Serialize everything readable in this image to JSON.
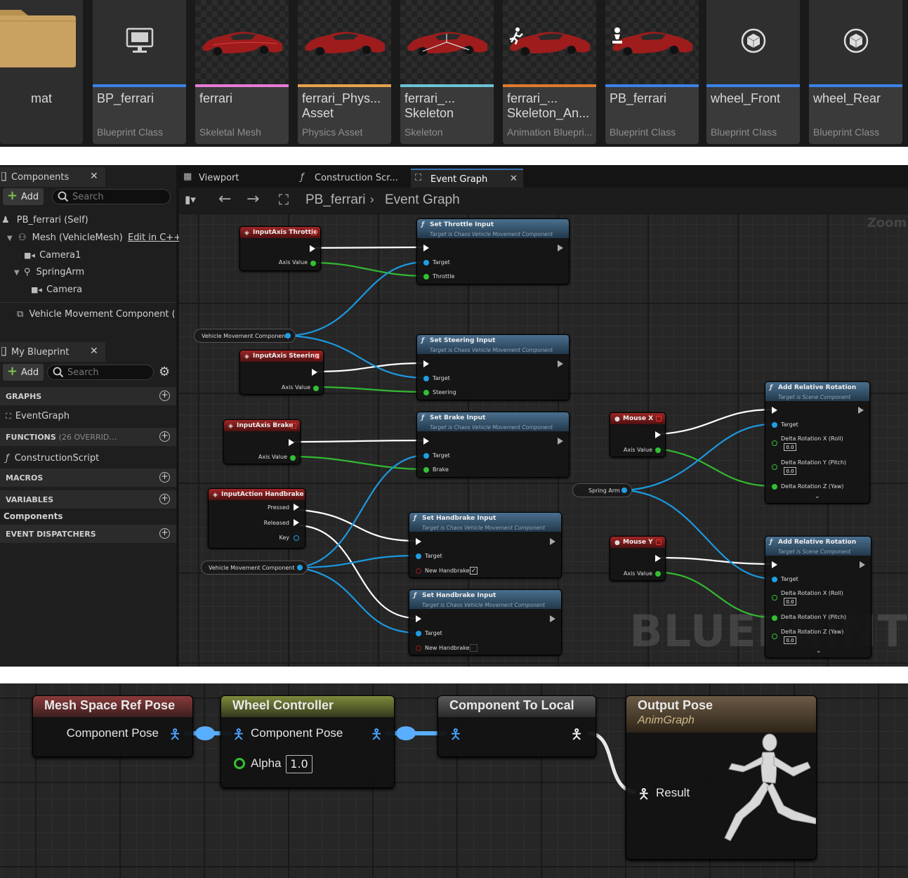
{
  "content_browser": {
    "folder": {
      "name": "mat"
    },
    "assets": [
      {
        "name": "BP_ferrari",
        "type": "Blueprint Class",
        "color": "#3a82e8",
        "thumb": "pawn-monitor-icon"
      },
      {
        "name": "ferrari",
        "type": "Skeletal Mesh",
        "color": "#e67bd8",
        "thumb": "red-car"
      },
      {
        "name": "ferrari_Phys...\nAsset",
        "type": "Physics Asset",
        "color": "#e9a24b",
        "thumb": "red-car"
      },
      {
        "name": "ferrari_...\nSkeleton",
        "type": "Skeleton",
        "color": "#6cc3d6",
        "thumb": "red-car"
      },
      {
        "name": "ferrari_...\nSkeleton_An...",
        "type": "Animation Bluepri...",
        "color": "#e07a2a",
        "thumb": "red-car"
      },
      {
        "name": "PB_ferrari",
        "type": "Blueprint Class",
        "color": "#3a82e8",
        "thumb": "red-car"
      },
      {
        "name": "wheel_Front",
        "type": "Blueprint Class",
        "color": "#3a82e8",
        "thumb": "cube-icon"
      },
      {
        "name": "wheel_Rear",
        "type": "Blueprint Class",
        "color": "#3a82e8",
        "thumb": "cube-icon"
      }
    ]
  },
  "components_panel": {
    "title": "Components",
    "add_label": "Add",
    "search_placeholder": "Search",
    "tree": [
      {
        "label": "PB_ferrari (Self)"
      },
      {
        "label": "Mesh (VehicleMesh)",
        "action": "Edit in C++"
      },
      {
        "label": "Camera1"
      },
      {
        "label": "SpringArm"
      },
      {
        "label": "Camera"
      },
      {
        "label": "Vehicle Movement Component (Ve"
      }
    ]
  },
  "my_blueprint": {
    "title": "My Blueprint",
    "add_label": "Add",
    "search_placeholder": "Search",
    "sections": {
      "graphs": "GRAPHS",
      "graph_item": "EventGraph",
      "functions": "FUNCTIONS",
      "functions_sub": "(26 OVERRID…",
      "function_item": "ConstructionScript",
      "macros": "MACROS",
      "variables": "VARIABLES",
      "variables_item": "Components",
      "dispatchers": "EVENT DISPATCHERS"
    }
  },
  "doc_tabs": [
    {
      "label": "Viewport"
    },
    {
      "label": "Construction Scr..."
    },
    {
      "label": "Event Graph",
      "active": true
    }
  ],
  "breadcrumb": {
    "root": "PB_ferrari",
    "current": "Event Graph"
  },
  "zoom_label": "Zoom -",
  "watermark": "BLUEPRINT",
  "nodes": {
    "throttle_event": {
      "title": "InputAxis Throttle",
      "pin": "Axis Value"
    },
    "steering_event": {
      "title": "InputAxis Steering",
      "pin": "Axis Value"
    },
    "brake_event": {
      "title": "InputAxis Brake",
      "pin": "Axis Value"
    },
    "handbrake_event": {
      "title": "InputAction Handbrake",
      "pins": [
        "Pressed",
        "Released",
        "Key"
      ]
    },
    "vmc_var": "Vehicle Movement Component",
    "spring_arm_var": "Spring Arm",
    "set_throttle": {
      "title": "Set Throttle Input",
      "sub": "Target is Chaos Vehicle Movement Component",
      "pins": [
        "Target",
        "Throttle"
      ]
    },
    "set_steering": {
      "title": "Set Steering Input",
      "sub": "Target is Chaos Vehicle Movement Component",
      "pins": [
        "Target",
        "Steering"
      ]
    },
    "set_brake": {
      "title": "Set Brake Input",
      "sub": "Target is Chaos Vehicle Movement Component",
      "pins": [
        "Target",
        "Brake"
      ]
    },
    "set_handbrake_1": {
      "title": "Set Handbrake Input",
      "sub": "Target is Chaos Vehicle Movement Component",
      "pins": [
        "Target",
        "New Handbrake"
      ],
      "checked": true
    },
    "set_handbrake_2": {
      "title": "Set Handbrake Input",
      "sub": "Target is Chaos Vehicle Movement Component",
      "pins": [
        "Target",
        "New Handbrake"
      ],
      "checked": false
    },
    "mouse_x": {
      "title": "Mouse X",
      "pin": "Axis Value"
    },
    "mouse_y": {
      "title": "Mouse Y",
      "pin": "Axis Value"
    },
    "add_rot_1": {
      "title": "Add Relative Rotation",
      "sub": "Target is Scene Component",
      "pins": [
        "Target",
        "Delta Rotation X (Roll)",
        "Delta Rotation Y (Pitch)",
        "Delta Rotation Z (Yaw)"
      ],
      "values": [
        "0.0",
        "0.0"
      ]
    },
    "add_rot_2": {
      "title": "Add Relative Rotation",
      "sub": "Target is Scene Component",
      "pins": [
        "Target",
        "Delta Rotation X (Roll)",
        "Delta Rotation Y (Pitch)",
        "Delta Rotation Z (Yaw)"
      ],
      "values": [
        "0.0",
        "0.0"
      ]
    }
  },
  "anim_graph": {
    "ref_pose": {
      "title": "Mesh Space Ref Pose",
      "pin": "Component Pose"
    },
    "wheel_controller": {
      "title": "Wheel Controller",
      "pin": "Component Pose",
      "alpha_label": "Alpha",
      "alpha": "1.0"
    },
    "comp_to_local": {
      "title": "Component To Local"
    },
    "output_pose": {
      "title": "Output Pose",
      "sub": "AnimGraph",
      "pin": "Result"
    }
  },
  "colors": {
    "exec": "#ffffff",
    "object_pin": "#1f9ee6",
    "float_pin": "#33c033",
    "bool_pin": "#9b1b1b",
    "pose_pin": "#3f9fff",
    "function_header": "#3d6585",
    "event_header": "#8e2020"
  }
}
